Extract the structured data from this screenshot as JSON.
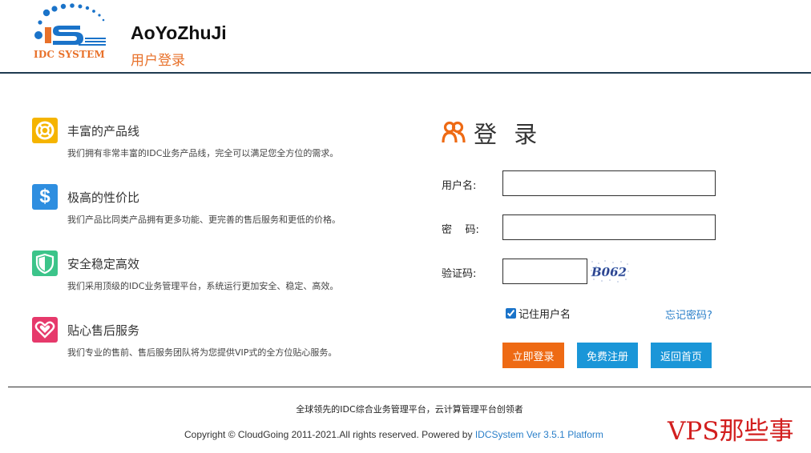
{
  "header": {
    "logo_text": "IDC SYSTEM",
    "site_name": "AoYoZhuJi",
    "subtitle": "用户登录"
  },
  "features": [
    {
      "icon": "lifebuoy-icon",
      "color": "#f5b400",
      "title": "丰富的产品线",
      "desc": "我们拥有非常丰富的IDC业务产品线，完全可以满足您全方位的需求。"
    },
    {
      "icon": "dollar-icon",
      "color": "#2e8ee0",
      "title": "极高的性价比",
      "desc": "我们产品比同类产品拥有更多功能、更完善的售后服务和更低的价格。"
    },
    {
      "icon": "shield-icon",
      "color": "#3cc48a",
      "title": "安全稳定高效",
      "desc": "我们采用顶级的IDC业务管理平台，系统运行更加安全、稳定、高效。"
    },
    {
      "icon": "heart-icon",
      "color": "#e6396b",
      "title": "贴心售后服务",
      "desc": "我们专业的售前、售后服务团队将为您提供VIP式的全方位贴心服务。"
    }
  ],
  "login": {
    "title": "登 录",
    "username_label": "用户名:",
    "username_value": "",
    "password_label": "密    码:",
    "password_value": "",
    "captcha_label": "验证码:",
    "captcha_value": "",
    "captcha_text": "B062",
    "remember_label": "记住用户名",
    "remember_checked": true,
    "forgot_label": "忘记密码?",
    "login_button": "立即登录",
    "register_button": "免费注册",
    "home_button": "返回首页"
  },
  "footer": {
    "slogan": "全球领先的IDC综合业务管理平台，云计算管理平台创领者",
    "copyright_prefix": "Copyright © CloudGoing 2011-2021.All rights reserved. Powered by ",
    "copyright_link": "IDCSystem Ver 3.5.1 Platform"
  },
  "watermark": "VPS那些事",
  "colors": {
    "accent_orange": "#ee6a14",
    "accent_blue": "#1a96d8",
    "link_blue": "#2a7fc9",
    "header_line": "#1f3b50"
  }
}
